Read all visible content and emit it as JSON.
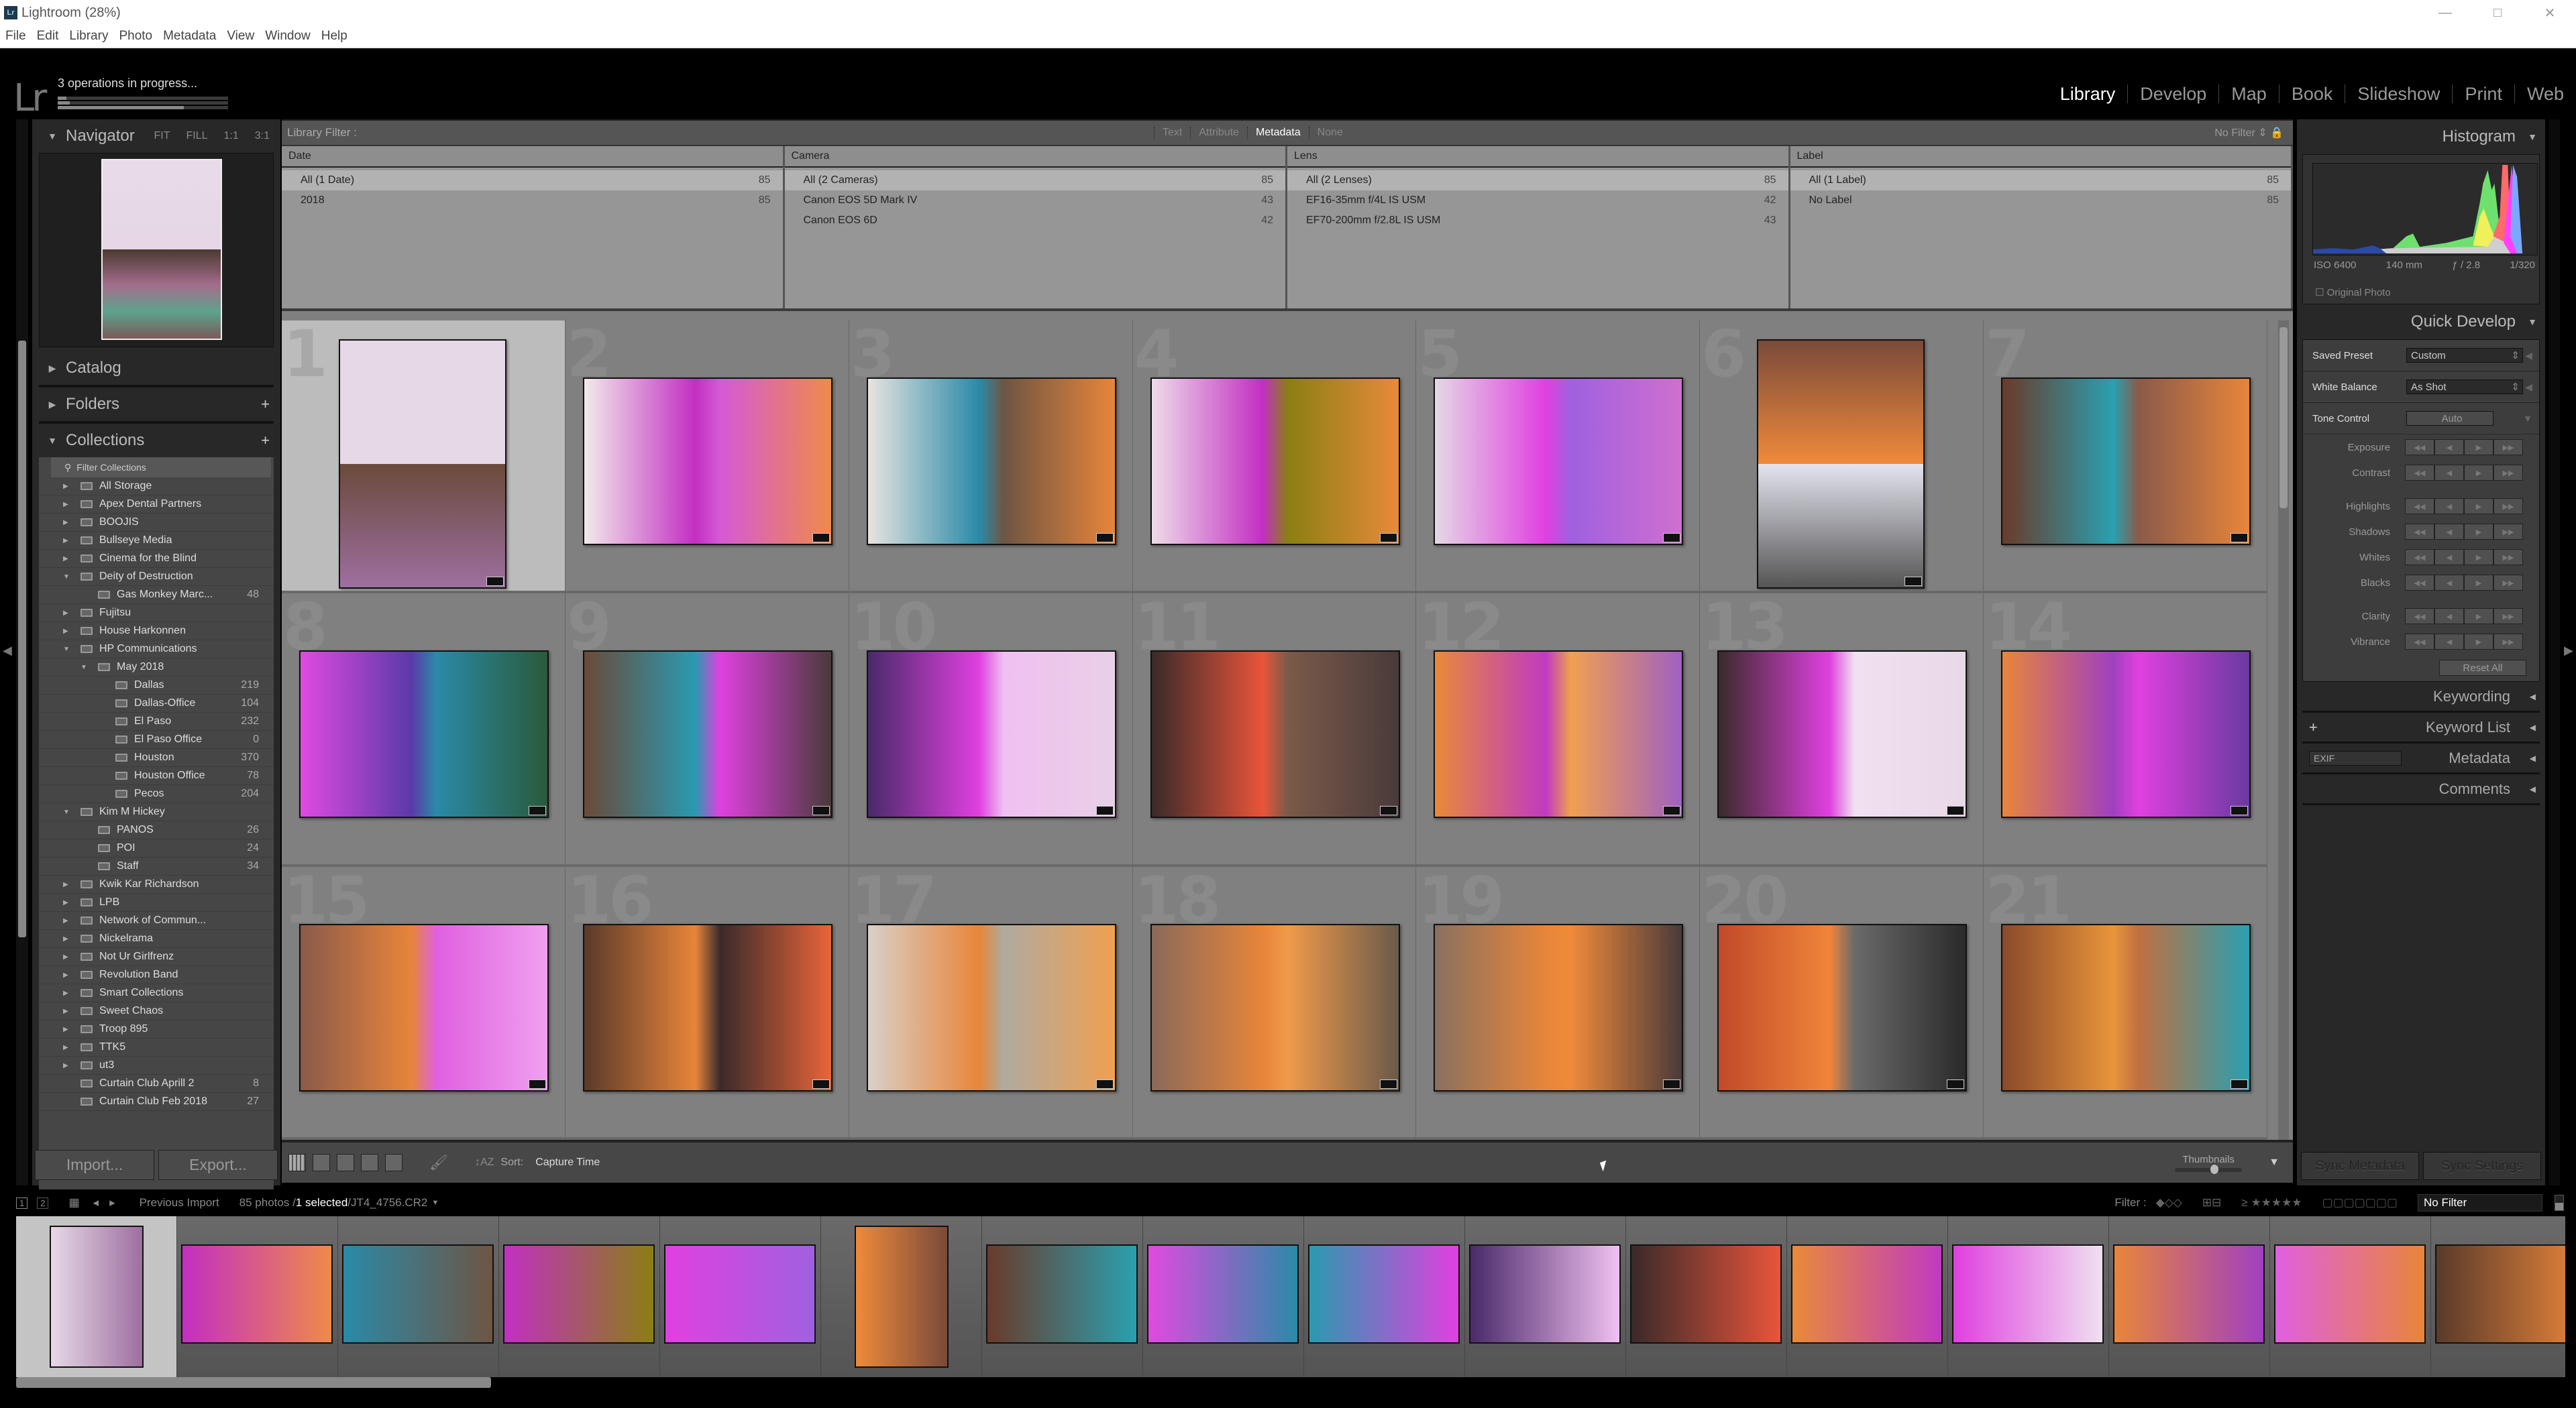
{
  "window": {
    "title": "Lightroom (28%)",
    "app_badge": "Lr",
    "controls": [
      "—",
      "□",
      "✕"
    ]
  },
  "menu": [
    "File",
    "Edit",
    "Library",
    "Photo",
    "Metadata",
    "View",
    "Window",
    "Help"
  ],
  "identity": {
    "logo": "Lr",
    "status": "3 operations in progress...",
    "progress": [
      0.05,
      0.07,
      0.74
    ]
  },
  "modules": [
    {
      "label": "Library",
      "active": true
    },
    {
      "label": "Develop",
      "active": false
    },
    {
      "label": "Map",
      "active": false
    },
    {
      "label": "Book",
      "active": false
    },
    {
      "label": "Slideshow",
      "active": false
    },
    {
      "label": "Print",
      "active": false
    },
    {
      "label": "Web",
      "active": false
    }
  ],
  "left_panel": {
    "navigator": {
      "title": "Navigator",
      "zoom_options": [
        "FIT",
        "FILL",
        "1:1",
        "3:1"
      ]
    },
    "catalog": "Catalog",
    "folders": "Folders",
    "collections": {
      "title": "Collections",
      "filter_placeholder": "Filter Collections",
      "items": [
        {
          "label": "All Storage",
          "depth": 0,
          "type": "set",
          "expanded": false,
          "count": ""
        },
        {
          "label": "Apex Dental Partners",
          "depth": 0,
          "type": "set",
          "expanded": false,
          "count": ""
        },
        {
          "label": "BOOJIS",
          "depth": 0,
          "type": "set",
          "expanded": false,
          "count": ""
        },
        {
          "label": "Bullseye Media",
          "depth": 0,
          "type": "set",
          "expanded": false,
          "count": ""
        },
        {
          "label": "Cinema for the Blind",
          "depth": 0,
          "type": "set",
          "expanded": false,
          "count": ""
        },
        {
          "label": "Deity of Destruction",
          "depth": 0,
          "type": "set",
          "expanded": true,
          "count": ""
        },
        {
          "label": "Gas Monkey Marc...",
          "depth": 1,
          "type": "collection",
          "count": "48"
        },
        {
          "label": "Fujitsu",
          "depth": 0,
          "type": "set",
          "expanded": false,
          "count": ""
        },
        {
          "label": "House Harkonnen",
          "depth": 0,
          "type": "set",
          "expanded": false,
          "count": ""
        },
        {
          "label": "HP Communications",
          "depth": 0,
          "type": "set",
          "expanded": true,
          "count": ""
        },
        {
          "label": "May 2018",
          "depth": 1,
          "type": "set",
          "expanded": true,
          "count": ""
        },
        {
          "label": "Dallas",
          "depth": 2,
          "type": "collection",
          "count": "219"
        },
        {
          "label": "Dallas-Office",
          "depth": 2,
          "type": "collection",
          "count": "104"
        },
        {
          "label": "El Paso",
          "depth": 2,
          "type": "collection",
          "count": "232"
        },
        {
          "label": "El Paso Office",
          "depth": 2,
          "type": "collection",
          "count": "0"
        },
        {
          "label": "Houston",
          "depth": 2,
          "type": "collection",
          "count": "370"
        },
        {
          "label": "Houston Office",
          "depth": 2,
          "type": "collection",
          "count": "78"
        },
        {
          "label": "Pecos",
          "depth": 2,
          "type": "collection",
          "count": "204"
        },
        {
          "label": "Kim M Hickey",
          "depth": 0,
          "type": "set",
          "expanded": true,
          "count": ""
        },
        {
          "label": "PANOS",
          "depth": 1,
          "type": "collection",
          "count": "26"
        },
        {
          "label": "POI",
          "depth": 1,
          "type": "collection",
          "count": "24"
        },
        {
          "label": "Staff",
          "depth": 1,
          "type": "collection",
          "count": "34"
        },
        {
          "label": "Kwik Kar Richardson",
          "depth": 0,
          "type": "set",
          "expanded": false,
          "count": ""
        },
        {
          "label": "LPB",
          "depth": 0,
          "type": "set",
          "expanded": false,
          "count": ""
        },
        {
          "label": "Network of Commun...",
          "depth": 0,
          "type": "set",
          "expanded": false,
          "count": ""
        },
        {
          "label": "Nickelrama",
          "depth": 0,
          "type": "set",
          "expanded": false,
          "count": ""
        },
        {
          "label": "Not Ur Girlfrenz",
          "depth": 0,
          "type": "set",
          "expanded": false,
          "count": ""
        },
        {
          "label": "Revolution Band",
          "depth": 0,
          "type": "set",
          "expanded": false,
          "count": ""
        },
        {
          "label": "Smart Collections",
          "depth": 0,
          "type": "set",
          "expanded": false,
          "count": ""
        },
        {
          "label": "Sweet Chaos",
          "depth": 0,
          "type": "set",
          "expanded": false,
          "count": ""
        },
        {
          "label": "Troop 895",
          "depth": 0,
          "type": "set",
          "expanded": false,
          "count": ""
        },
        {
          "label": "TTK5",
          "depth": 0,
          "type": "set",
          "expanded": false,
          "count": ""
        },
        {
          "label": "ut3",
          "depth": 0,
          "type": "set",
          "expanded": false,
          "count": ""
        },
        {
          "label": "Curtain Club Aprill 2",
          "depth": 0,
          "type": "collection",
          "count": "8"
        },
        {
          "label": "Curtain Club Feb 2018",
          "depth": 0,
          "type": "collection",
          "count": "27"
        }
      ]
    },
    "import_label": "Import...",
    "export_label": "Export..."
  },
  "library_filter": {
    "label": "Library Filter :",
    "tabs": [
      {
        "label": "Text",
        "active": false
      },
      {
        "label": "Attribute",
        "active": false
      },
      {
        "label": "Metadata",
        "active": true
      },
      {
        "label": "None",
        "active": false
      }
    ],
    "preset": "No Filter",
    "columns": [
      {
        "header": "Date",
        "rows": [
          {
            "label": "All (1 Date)",
            "count": "85",
            "selected": true
          },
          {
            "label": "2018",
            "count": "85",
            "selected": false
          }
        ]
      },
      {
        "header": "Camera",
        "rows": [
          {
            "label": "All (2 Cameras)",
            "count": "85",
            "selected": true
          },
          {
            "label": "Canon EOS 5D Mark IV",
            "count": "43",
            "selected": false
          },
          {
            "label": "Canon EOS 6D",
            "count": "42",
            "selected": false
          }
        ]
      },
      {
        "header": "Lens",
        "rows": [
          {
            "label": "All (2 Lenses)",
            "count": "85",
            "selected": true
          },
          {
            "label": "EF16-35mm f/4L IS USM",
            "count": "42",
            "selected": false
          },
          {
            "label": "EF70-200mm f/2.8L IS USM",
            "count": "43",
            "selected": false
          }
        ]
      },
      {
        "header": "Label",
        "rows": [
          {
            "label": "All (1 Label)",
            "count": "85",
            "selected": true
          },
          {
            "label": "No Label",
            "count": "85",
            "selected": false
          }
        ]
      }
    ]
  },
  "grid": {
    "photos": [
      {
        "n": "1",
        "orient": "p",
        "selected": true,
        "colors": [
          "#e6d8e6",
          "#e6d8e6",
          "#6a4a3a",
          "#9e6fa0"
        ]
      },
      {
        "n": "2",
        "orient": "l",
        "colors": [
          "#f2eaea",
          "#c22fc2",
          "#d55ad5",
          "#ef8a4a"
        ]
      },
      {
        "n": "3",
        "orient": "l",
        "colors": [
          "#e8e4e0",
          "#2a8aa8",
          "#6e5544",
          "#e8853a"
        ]
      },
      {
        "n": "4",
        "orient": "l",
        "colors": [
          "#eedbe8",
          "#c22fc2",
          "#8a7f12",
          "#e88a3a"
        ]
      },
      {
        "n": "5",
        "orient": "l",
        "colors": [
          "#e4d8e4",
          "#e040e0",
          "#a060e0",
          "#d06fd0"
        ]
      },
      {
        "n": "6",
        "orient": "p",
        "colors": [
          "#7a4a3a",
          "#f08a3a",
          "#e4e4f0",
          "#555"
        ]
      },
      {
        "n": "7",
        "orient": "l",
        "colors": [
          "#6a3a2a",
          "#2aa0b0",
          "#8a5a4a",
          "#e8853a"
        ]
      },
      {
        "n": "8",
        "orient": "l",
        "colors": [
          "#e04ae0",
          "#5a3aa8",
          "#2a8aa8",
          "#2a5a3a"
        ]
      },
      {
        "n": "9",
        "orient": "l",
        "colors": [
          "#6a4a3a",
          "#2a9ab0",
          "#e040e0",
          "#4a3a3a"
        ]
      },
      {
        "n": "10",
        "orient": "l",
        "colors": [
          "#4a2a6a",
          "#e040e0",
          "#f0c0f0",
          "#e8d0e8"
        ]
      },
      {
        "n": "11",
        "orient": "l",
        "colors": [
          "#3a2a2a",
          "#e8553a",
          "#7a5a4a",
          "#4a3a3a"
        ]
      },
      {
        "n": "12",
        "orient": "l",
        "colors": [
          "#e88a3a",
          "#c03ac0",
          "#f0a050",
          "#a060c0"
        ]
      },
      {
        "n": "13",
        "orient": "l",
        "colors": [
          "#3a2a2a",
          "#e040e0",
          "#f0e0f0",
          "#e8d8e8"
        ]
      },
      {
        "n": "14",
        "orient": "l",
        "colors": [
          "#e8853a",
          "#a040c0",
          "#e040e0",
          "#6a3aa0"
        ]
      },
      {
        "n": "15",
        "orient": "l",
        "colors": [
          "#8a5a4a",
          "#e8853a",
          "#e060e0",
          "#f0a0f0"
        ]
      },
      {
        "n": "16",
        "orient": "l",
        "colors": [
          "#5a3a2a",
          "#e8853a",
          "#3a2a2a",
          "#e8653a"
        ]
      },
      {
        "n": "17",
        "orient": "l",
        "colors": [
          "#d8d0c8",
          "#e8853a",
          "#b0aaa0",
          "#f0a050"
        ]
      },
      {
        "n": "18",
        "orient": "l",
        "colors": [
          "#8a6a5a",
          "#e8853a",
          "#f09a4a",
          "#6a5a4a"
        ]
      },
      {
        "n": "19",
        "orient": "l",
        "colors": [
          "#8a7060",
          "#e8853a",
          "#f08a3a",
          "#4a3a3a"
        ]
      },
      {
        "n": "20",
        "orient": "l",
        "colors": [
          "#c04a2a",
          "#f0853a",
          "#6a6a6a",
          "#2a2a2a"
        ]
      },
      {
        "n": "21",
        "orient": "l",
        "colors": [
          "#8a4a2a",
          "#e8953a",
          "#c07040",
          "#2aa0b0"
        ]
      }
    ]
  },
  "toolbar": {
    "view_modes": [
      "grid-view",
      "loupe-view",
      "compare-view",
      "survey-view",
      "people-view"
    ],
    "sort_label": "Sort:",
    "sort_value": "Capture Time",
    "thumbnails_label": "Thumbnails",
    "thumbnail_size": 0.6
  },
  "right_panel": {
    "histogram": {
      "title": "Histogram",
      "iso": "ISO 6400",
      "focal": "140 mm",
      "aperture": "ƒ / 2.8",
      "shutter": "1/320",
      "original_photo": "Original Photo"
    },
    "quick_develop": {
      "title": "Quick Develop",
      "saved_preset_label": "Saved Preset",
      "saved_preset_value": "Custom",
      "white_balance_label": "White Balance",
      "white_balance_value": "As Shot",
      "tone_control_label": "Tone Control",
      "auto_label": "Auto",
      "adjustments": [
        "Exposure",
        "Contrast",
        "Highlights",
        "Shadows",
        "Whites",
        "Blacks",
        "Clarity",
        "Vibrance"
      ],
      "reset_label": "Reset All"
    },
    "sections": [
      "Keywording",
      "Keyword List",
      "Metadata",
      "Comments"
    ],
    "metadata_preset": "EXIF",
    "sync_metadata": "Sync Metadata",
    "sync_settings": "Sync Settings"
  },
  "filmstrip": {
    "source": "Previous Import",
    "count_text": "85 photos /",
    "selected_text": "1 selected",
    "file_text": "/JT4_4756.CR2",
    "filter_label": "Filter :",
    "filter_value": "No Filter",
    "thumbs": [
      {
        "orient": "p",
        "selected": true,
        "colors": [
          "#e6d8e6",
          "#9e6fa0"
        ]
      },
      {
        "orient": "l",
        "colors": [
          "#c22fc2",
          "#ef8a4a"
        ]
      },
      {
        "orient": "l",
        "colors": [
          "#2a8aa8",
          "#6e5544"
        ]
      },
      {
        "orient": "l",
        "colors": [
          "#c22fc2",
          "#8a7f12"
        ]
      },
      {
        "orient": "l",
        "colors": [
          "#e040e0",
          "#a060e0"
        ]
      },
      {
        "orient": "p",
        "colors": [
          "#f08a3a",
          "#7a4a3a"
        ]
      },
      {
        "orient": "l",
        "colors": [
          "#6a3a2a",
          "#2aa0b0"
        ]
      },
      {
        "orient": "l",
        "colors": [
          "#e04ae0",
          "#2a8aa8"
        ]
      },
      {
        "orient": "l",
        "colors": [
          "#2a9ab0",
          "#e040e0"
        ]
      },
      {
        "orient": "l",
        "colors": [
          "#4a2a6a",
          "#f0c0f0"
        ]
      },
      {
        "orient": "l",
        "colors": [
          "#3a2a2a",
          "#e8553a"
        ]
      },
      {
        "orient": "l",
        "colors": [
          "#e88a3a",
          "#c03ac0"
        ]
      },
      {
        "orient": "l",
        "colors": [
          "#e040e0",
          "#f0e0f0"
        ]
      },
      {
        "orient": "l",
        "colors": [
          "#e8853a",
          "#a040c0"
        ]
      },
      {
        "orient": "l",
        "colors": [
          "#e060e0",
          "#e8853a"
        ]
      },
      {
        "orient": "l",
        "colors": [
          "#5a3a2a",
          "#e8853a"
        ]
      }
    ]
  }
}
